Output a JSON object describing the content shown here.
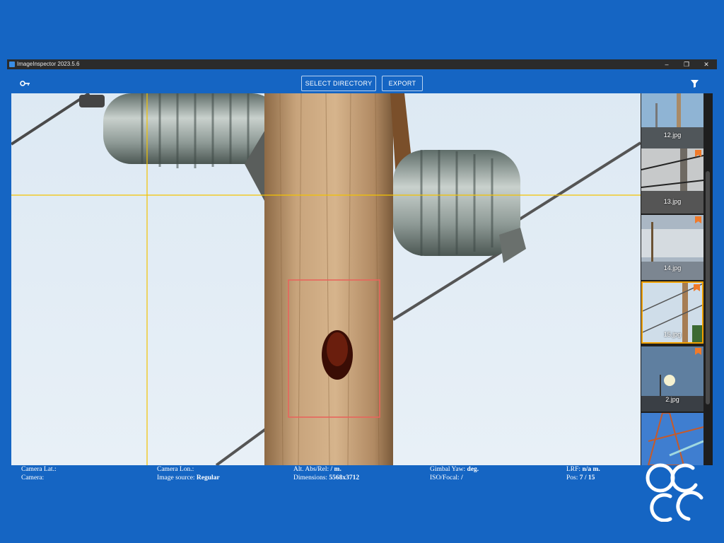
{
  "window": {
    "title": "ImageInspector 2023.5.6",
    "controls": [
      "–",
      "❐",
      "✕"
    ]
  },
  "toolbar": {
    "key_icon": "key-icon",
    "select_directory_label": "SELECT DIRECTORY",
    "export_label": "EXPORT",
    "filter_icon": "filter-icon"
  },
  "thumbnails": [
    {
      "caption": "12.jpg",
      "flagged": false,
      "selected": false
    },
    {
      "caption": "13.jpg",
      "flagged": true,
      "selected": false
    },
    {
      "caption": "14.jpg",
      "flagged": true,
      "selected": false
    },
    {
      "caption": "15.jpg",
      "flagged": true,
      "selected": true
    },
    {
      "caption": "2.jpg",
      "flagged": true,
      "selected": false
    },
    {
      "caption": "",
      "flagged": false,
      "selected": false
    }
  ],
  "status": {
    "camera_lat_label": "Camera Lat.:",
    "camera_label": "Camera:",
    "camera_lon_label": "Camera Lon.:",
    "image_source_label": "Image source:",
    "image_source_value": "Regular",
    "alt_label": "Alt. Abs/Rel:",
    "alt_value": "/ m.",
    "dimensions_label": "Dimensions:",
    "dimensions_value": "5568x3712",
    "gimbal_yaw_label": "Gimbal Yaw:",
    "gimbal_yaw_value": "deg.",
    "iso_focal_label": "ISO/Focal:",
    "iso_focal_value": "/",
    "lrf_label": "LRF:",
    "lrf_value": "n/a m.",
    "pos_label": "Pos:",
    "pos_value": "7 / 15"
  },
  "colors": {
    "background": "#1565c3",
    "crosshair": "#f2c200",
    "detection_box": "#e8645c",
    "flag": "#f07a2a",
    "selected_border": "#f0a000"
  }
}
